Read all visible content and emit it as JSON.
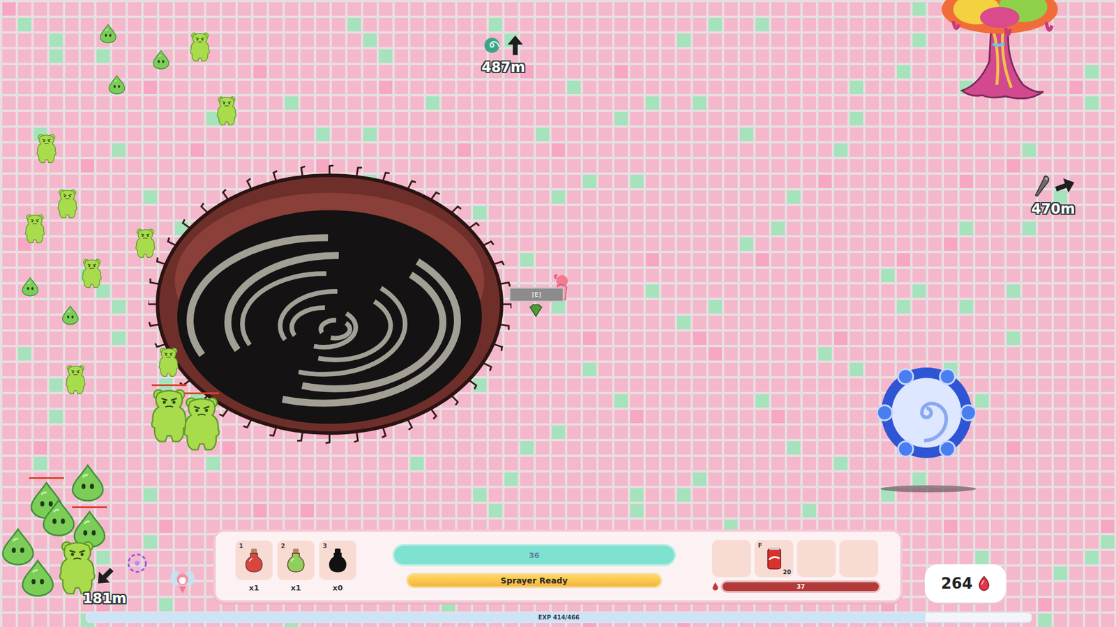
{
  "world_markers": [
    {
      "label": "487m",
      "direction": "up",
      "kind": "portal"
    },
    {
      "label": "470m",
      "direction": "right",
      "kind": "weapon"
    },
    {
      "label": "181m",
      "direction": "down-left",
      "kind": "none"
    }
  ],
  "interact_prompt": "[E]",
  "enemies": [
    {
      "kind": "drop",
      "damaged": false
    },
    {
      "kind": "drop",
      "damaged": false
    },
    {
      "kind": "drop",
      "damaged": false
    },
    {
      "kind": "drop",
      "damaged": false
    },
    {
      "kind": "drop",
      "damaged": false
    },
    {
      "kind": "bear",
      "damaged": false
    },
    {
      "kind": "bear",
      "damaged": false
    },
    {
      "kind": "bear",
      "damaged": false
    },
    {
      "kind": "bear",
      "damaged": false
    },
    {
      "kind": "bear",
      "damaged": false
    },
    {
      "kind": "bear",
      "damaged": false
    },
    {
      "kind": "bear",
      "damaged": false
    },
    {
      "kind": "bear",
      "damaged": false
    },
    {
      "kind": "bear",
      "damaged": false
    },
    {
      "kind": "big-bear",
      "damaged": true
    },
    {
      "kind": "big-bear",
      "damaged": true
    },
    {
      "kind": "big-drop",
      "damaged": false
    },
    {
      "kind": "big-drop",
      "damaged": true
    },
    {
      "kind": "big-drop",
      "damaged": false
    },
    {
      "kind": "big-drop",
      "damaged": true
    },
    {
      "kind": "big-bear",
      "damaged": false
    },
    {
      "kind": "big-drop",
      "damaged": false
    },
    {
      "kind": "big-drop",
      "damaged": false
    }
  ],
  "hud": {
    "potions": [
      {
        "key": "1",
        "count": "x1",
        "color": "#d9453f"
      },
      {
        "key": "2",
        "count": "x1",
        "color": "#8fd05a"
      },
      {
        "key": "3",
        "count": "x0",
        "color": "#111111"
      }
    ],
    "health": {
      "value": "36",
      "level": 1.0
    },
    "sprayer": {
      "label": "Sprayer Ready",
      "level": 1.0
    },
    "items": [
      {
        "kind": "empty",
        "key": "",
        "count": ""
      },
      {
        "kind": "soda",
        "key": "F",
        "count": "20"
      },
      {
        "kind": "empty",
        "key": "",
        "count": ""
      },
      {
        "kind": "empty",
        "key": "",
        "count": ""
      }
    ],
    "ammo": {
      "value": "37",
      "level": 1.0
    },
    "currency": "264"
  },
  "exp": {
    "label": "EXP 414/466",
    "level": 0.888
  }
}
